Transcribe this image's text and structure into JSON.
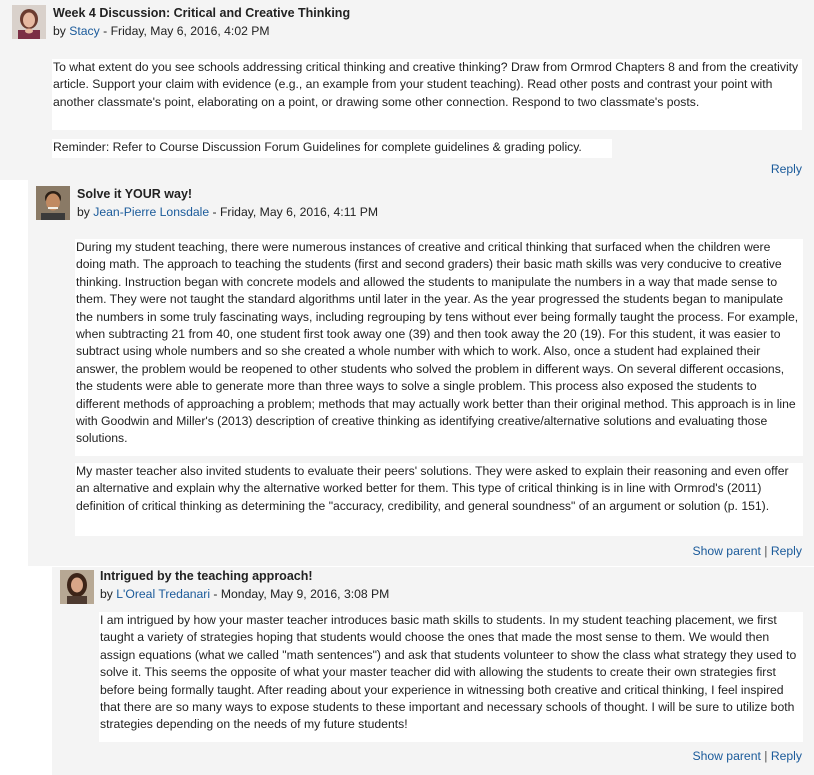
{
  "posts": [
    {
      "subject": "Week 4 Discussion: Critical and Creative Thinking",
      "by": "by",
      "author": "Stacy",
      "date": " - Friday, May 6, 2016, 4:02 PM",
      "paragraphs": [
        "To what extent do you see schools addressing critical thinking and creative thinking?  Draw from Ormrod Chapters 8 and from the creativity article.  Support your claim with evidence (e.g., an example from your student teaching).  Read other posts and contrast your point with another classmate's point, elaborating on a point, or drawing some other connection.  Respond to two classmate's posts.",
        "Reminder: Refer to Course Discussion Forum Guidelines  for complete guidelines & grading policy."
      ],
      "reply": "Reply"
    },
    {
      "subject": "Solve it YOUR way!",
      "by": "by",
      "author": "Jean-Pierre Lonsdale",
      "date": " - Friday, May 6, 2016, 4:11 PM",
      "paragraphs": [
        "During my student teaching, there were numerous instances of creative and critical thinking that surfaced when the children were doing math. The approach to teaching the students (first and second graders) their basic math skills was very conducive to creative thinking. Instruction began with concrete models and allowed the students to manipulate the numbers in a way that made sense to them. They were not taught the standard algorithms until later in the year. As the year progressed the students began to manipulate the numbers in some truly fascinating ways, including regrouping by tens without ever being formally taught the process. For example, when subtracting 21 from 40, one student first took away one (39) and then took away the 20 (19). For this student, it was easier to subtract using whole numbers and so she created a whole number with which to work. Also, once a student had explained their answer, the problem would be reopened to other students who solved the problem in different ways. On several different occasions, the students were able to generate more than three ways to solve a single problem. This process also exposed the students to different methods of approaching a problem; methods that may actually work better than their original method. This approach is in line with Goodwin and Miller's (2013) description of creative thinking as identifying creative/alternative solutions and evaluating those solutions.",
        "My master teacher also invited students to evaluate their peers' solutions. They were asked to explain their reasoning and even offer an alternative and explain why the alternative worked better for them. This type of critical thinking is in line with Ormrod's (2011) definition of critical thinking as determining the \"accuracy, credibility, and general soundness\" of an argument or solution (p. 151)."
      ],
      "show_parent": "Show parent",
      "separator": "|",
      "reply": "Reply"
    },
    {
      "subject": "Intrigued by the teaching approach!",
      "by": "by",
      "author": "L'Oreal Tredanari",
      "date": " - Monday, May 9, 2016, 3:08 PM",
      "paragraphs": [
        "I am intrigued by how your master teacher introduces basic math skills to students. In my student teaching placement, we first taught a variety of strategies hoping that students would choose the ones that made the most sense to them. We would then assign equations (what we called \"math sentences\") and ask that students volunteer to show the class what strategy they used to solve it. This seems the opposite of what your master teacher did with allowing the students to create their own strategies first before being formally taught. After reading about your experience in witnessing both creative and critical thinking, I feel inspired that there are so many ways to expose students to these important and necessary schools of thought. I will be sure to utilize both strategies depending on the needs of my future students!"
      ],
      "show_parent": "Show parent",
      "separator": "|",
      "reply": "Reply"
    }
  ],
  "colors": {
    "post_background": "#f4f4f4",
    "content_background": "#ffffff",
    "link": "#1a5a9a"
  }
}
